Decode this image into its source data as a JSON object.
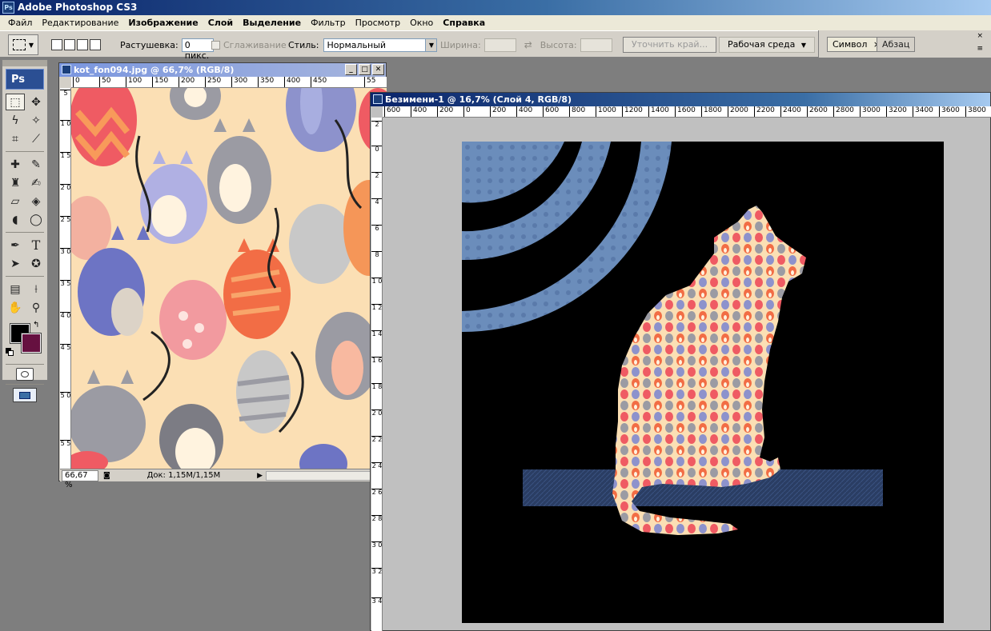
{
  "app": {
    "title": "Adobe Photoshop CS3",
    "badge": "Ps"
  },
  "menu": [
    "Файл",
    "Редактирование",
    "Изображение",
    "Слой",
    "Выделение",
    "Фильтр",
    "Просмотр",
    "Окно",
    "Справка"
  ],
  "options": {
    "feather_label": "Растушевка:",
    "feather_value": "0 пикс.",
    "antialias_label": "Сглаживание",
    "style_label": "Стиль:",
    "style_value": "Нормальный",
    "width_label": "Ширина:",
    "height_label": "Высота:",
    "refine_edge": "Уточнить край...",
    "workspace": "Рабочая среда"
  },
  "palettes": {
    "tab1": "Символ",
    "tab2": "Абзац"
  },
  "toolbox": {
    "badge": "Ps",
    "fg_color": "#000000",
    "bg_color": "#661040"
  },
  "doc1": {
    "title": "kot_fon094.jpg @ 66,7% (RGB/8)",
    "zoom": "66,67 %",
    "doc_info": "Док: 1,15M/1,15M",
    "ruler_h": [
      "0",
      "50",
      "100",
      "150",
      "200",
      "250",
      "300",
      "350",
      "400",
      "450",
      "55"
    ],
    "ruler_v": [
      "5",
      "1 0",
      "1 5",
      "2 0",
      "2 5",
      "3 0",
      "3 5",
      "4 0",
      "4 5",
      "5 0",
      "5 5"
    ]
  },
  "doc2": {
    "title": "Безимени-1 @ 16,7% (Слой 4, RGB/8)",
    "ruler_h": [
      "600",
      "400",
      "200",
      "0",
      "200",
      "400",
      "600",
      "800",
      "1000",
      "1200",
      "1400",
      "1600",
      "1800",
      "2000",
      "2200",
      "2400",
      "2600",
      "2800",
      "3000",
      "3200",
      "3400",
      "3600",
      "3800"
    ],
    "ruler_v": [
      "2",
      "0",
      "2",
      "4",
      "6",
      "8",
      "1 0",
      "1 2",
      "1 4",
      "1 6",
      "1 8",
      "2 0",
      "2 2",
      "2 4",
      "2 6",
      "2 8",
      "3 0",
      "3 2",
      "3 4"
    ]
  },
  "colors": {
    "canvas_bg": "#000000",
    "pattern_bg": "#fbdfb4",
    "arc_blue": "#6b8dbb",
    "denim": "#2a3d63",
    "workspace_gray": "#c0c0c0"
  }
}
